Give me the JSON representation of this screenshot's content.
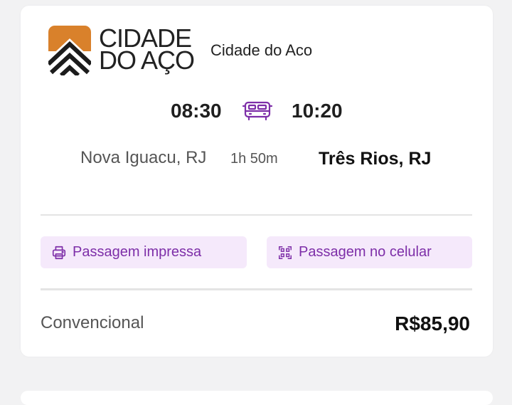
{
  "company": {
    "logo_line1": "CIDADE",
    "logo_line2": "DO AÇO",
    "name": "Cidade do Aco",
    "brand_color": "#d9812b"
  },
  "trip": {
    "departure_time": "08:30",
    "arrival_time": "10:20",
    "origin": "Nova Iguacu, RJ",
    "duration": "1h 50m",
    "destination": "Três Rios, RJ",
    "vehicle_icon": "bus-icon"
  },
  "ticket_options": {
    "printed_label": "Passagem impressa",
    "printed_icon": "printer-icon",
    "mobile_label": "Passagem no celular",
    "mobile_icon": "qr-code-icon",
    "accent_color": "#7d2ea8"
  },
  "fare": {
    "class": "Convencional",
    "price": "R$85,90"
  }
}
